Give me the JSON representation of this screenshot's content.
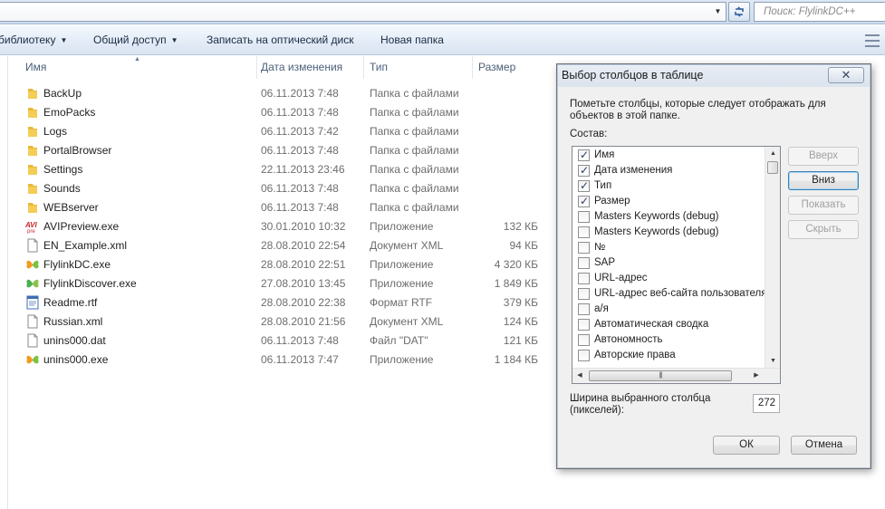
{
  "search": {
    "placeholder": "Поиск: FlylinkDC++"
  },
  "toolbar": {
    "library_label": "библиотеку",
    "share_label": "Общий доступ",
    "burn_label": "Записать на оптический диск",
    "new_folder_label": "Новая папка"
  },
  "columns": {
    "name": "Имя",
    "date": "Дата изменения",
    "type": "Тип",
    "size": "Размер"
  },
  "files": [
    {
      "name": "BackUp",
      "date": "06.11.2013 7:48",
      "type": "Папка с файлами",
      "size": "",
      "icon": "folder-icon"
    },
    {
      "name": "EmoPacks",
      "date": "06.11.2013 7:48",
      "type": "Папка с файлами",
      "size": "",
      "icon": "folder-icon"
    },
    {
      "name": "Logs",
      "date": "06.11.2013 7:42",
      "type": "Папка с файлами",
      "size": "",
      "icon": "folder-icon"
    },
    {
      "name": "PortalBrowser",
      "date": "06.11.2013 7:48",
      "type": "Папка с файлами",
      "size": "",
      "icon": "folder-icon"
    },
    {
      "name": "Settings",
      "date": "22.11.2013 23:46",
      "type": "Папка с файлами",
      "size": "",
      "icon": "folder-icon"
    },
    {
      "name": "Sounds",
      "date": "06.11.2013 7:48",
      "type": "Папка с файлами",
      "size": "",
      "icon": "folder-icon"
    },
    {
      "name": "WEBserver",
      "date": "06.11.2013 7:48",
      "type": "Папка с файлами",
      "size": "",
      "icon": "folder-icon"
    },
    {
      "name": "AVIPreview.exe",
      "date": "30.01.2010 10:32",
      "type": "Приложение",
      "size": "132 КБ",
      "icon": "avi-app-icon"
    },
    {
      "name": "EN_Example.xml",
      "date": "28.08.2010 22:54",
      "type": "Документ XML",
      "size": "94 КБ",
      "icon": "document-icon"
    },
    {
      "name": "FlylinkDC.exe",
      "date": "28.08.2010 22:51",
      "type": "Приложение",
      "size": "4 320 КБ",
      "icon": "butterfly-icon"
    },
    {
      "name": "FlylinkDiscover.exe",
      "date": "27.08.2010 13:45",
      "type": "Приложение",
      "size": "1 849 КБ",
      "icon": "green-butterfly-icon"
    },
    {
      "name": "Readme.rtf",
      "date": "28.08.2010 22:38",
      "type": "Формат RTF",
      "size": "379 КБ",
      "icon": "wordpad-icon"
    },
    {
      "name": "Russian.xml",
      "date": "28.08.2010 21:56",
      "type": "Документ XML",
      "size": "124 КБ",
      "icon": "document-icon"
    },
    {
      "name": "unins000.dat",
      "date": "06.11.2013 7:48",
      "type": "Файл \"DAT\"",
      "size": "121 КБ",
      "icon": "document-icon"
    },
    {
      "name": "unins000.exe",
      "date": "06.11.2013 7:47",
      "type": "Приложение",
      "size": "1 184 КБ",
      "icon": "butterfly-icon"
    }
  ],
  "dialog": {
    "title": "Выбор столбцов в таблице",
    "close_label": "✕",
    "description_line1": "Пометьте столбцы, которые следует отображать для",
    "description_line2": "объектов в этой папке.",
    "list_label": "Состав:",
    "items": [
      {
        "label": "Имя",
        "checked": true
      },
      {
        "label": "Дата изменения",
        "checked": true
      },
      {
        "label": "Тип",
        "checked": true
      },
      {
        "label": "Размер",
        "checked": true
      },
      {
        "label": "Masters Keywords (debug)",
        "checked": false
      },
      {
        "label": "Masters Keywords (debug)",
        "checked": false
      },
      {
        "label": "№",
        "checked": false
      },
      {
        "label": "SAP",
        "checked": false
      },
      {
        "label": "URL-адрес",
        "checked": false
      },
      {
        "label": "URL-адрес веб-сайта пользователя",
        "checked": false
      },
      {
        "label": "а/я",
        "checked": false
      },
      {
        "label": "Автоматическая сводка",
        "checked": false
      },
      {
        "label": "Автономность",
        "checked": false
      },
      {
        "label": "Авторские права",
        "checked": false
      }
    ],
    "buttons": {
      "up": "Вверх",
      "down": "Вниз",
      "show": "Показать",
      "hide": "Скрыть",
      "ok": "ОК",
      "cancel": "Отмена"
    },
    "width_label_line1": "Ширина выбранного столбца",
    "width_label_line2": "(пикселей):",
    "width_value": "272"
  }
}
